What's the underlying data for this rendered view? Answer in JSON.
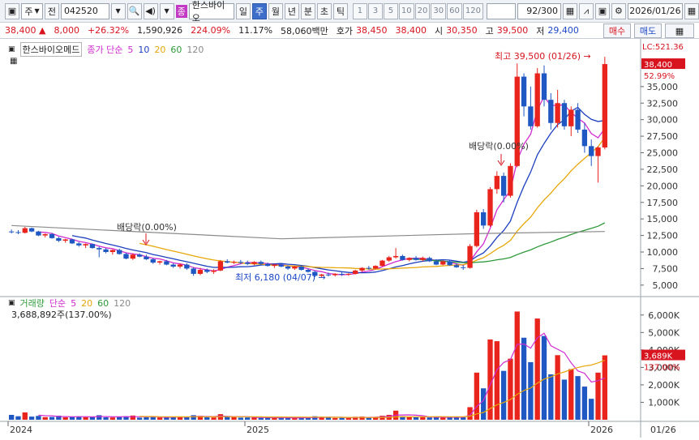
{
  "toolbar": {
    "type_label": "주",
    "prev_label": "전",
    "code": "042520",
    "badge": "종",
    "name": "한스바이오",
    "periods": [
      "일",
      "주",
      "월",
      "년",
      "분",
      "초",
      "틱"
    ],
    "active_period": "주",
    "intervals": [
      "1",
      "3",
      "5",
      "10",
      "20",
      "30",
      "60",
      "120"
    ],
    "count": "92/300",
    "date": "2026/01/26"
  },
  "quote": {
    "price": "38,400",
    "change": "8,000",
    "change_pct": "+26.32%",
    "volume": "1,590,926",
    "vol_ratio": "224.09%",
    "turnover": "11.17%",
    "amount": "58,060백만",
    "hoga_label": "호가",
    "ask": "38,450",
    "bid": "38,400",
    "open_label": "시",
    "open": "30,350",
    "high_label": "고",
    "high": "39,500",
    "low_label": "저",
    "low": "29,400",
    "buy_label": "매수",
    "sell_label": "매도"
  },
  "price_panel": {
    "title": "한스바이오메드",
    "ma_label": "종가 단순",
    "ma_periods": [
      "5",
      "10",
      "20",
      "60",
      "120"
    ],
    "lc_label": "LC:521.36",
    "current_price_tag": "38,400",
    "current_pct_tag": "52.99%",
    "max_annotation": "최고 39,500 (01/26)",
    "min_annotation": "최저 6,180 (04/07)",
    "div_annotation_1": "배당락(0.00%)",
    "div_annotation_2": "배당락(0.00%)",
    "y_ticks": [
      "35,000",
      "32,500",
      "30,000",
      "27,500",
      "25,000",
      "22,500",
      "20,000",
      "17,500",
      "15,000",
      "12,500",
      "10,000",
      "7,500",
      "5,000"
    ]
  },
  "volume_panel": {
    "title": "거래량",
    "ma_label": "단순",
    "ma_periods": [
      "5",
      "20",
      "60",
      "120"
    ],
    "last_volume": "3,688,892주(137.00%)",
    "current_tag": "3,689K",
    "current_pct_tag": "137.00%",
    "y_ticks": [
      "6,000K",
      "5,000K",
      "4,000K",
      "3,000K",
      "2,000K",
      "1,000K"
    ]
  },
  "x_axis": {
    "labels": [
      "2024",
      "2025",
      "2026"
    ],
    "right_label": "01/26"
  },
  "colors": {
    "up": "#e8241c",
    "down": "#1f57c3",
    "ma5": "#d02bd1",
    "ma10": "#1d3fbf",
    "ma20": "#e8a70a",
    "ma60": "#2d9a3a",
    "ma120": "#8a8a8a"
  },
  "chart_data": {
    "type": "candlestick",
    "price_ylim": [
      4000,
      40000
    ],
    "volume_ylim": [
      0,
      6500000
    ],
    "candles": [
      [
        13100,
        13400,
        12800,
        13000
      ],
      [
        13000,
        13300,
        12700,
        12900
      ],
      [
        12900,
        13800,
        12800,
        13600
      ],
      [
        13600,
        13700,
        13000,
        13100
      ],
      [
        13100,
        13200,
        12400,
        12500
      ],
      [
        12500,
        12800,
        12200,
        12700
      ],
      [
        12700,
        12900,
        12000,
        12100
      ],
      [
        12100,
        12300,
        11500,
        11700
      ],
      [
        11700,
        12000,
        11400,
        11900
      ],
      [
        11900,
        12000,
        11200,
        11300
      ],
      [
        11300,
        11500,
        10800,
        11000
      ],
      [
        11000,
        11300,
        10600,
        11200
      ],
      [
        11200,
        11300,
        10500,
        10600
      ],
      [
        10600,
        10800,
        9200,
        10400
      ],
      [
        10400,
        10600,
        9800,
        10000
      ],
      [
        10000,
        10400,
        9600,
        10300
      ],
      [
        10300,
        10500,
        9600,
        9700
      ],
      [
        9700,
        9900,
        8900,
        9000
      ],
      [
        9000,
        9800,
        8800,
        9600
      ],
      [
        9600,
        9800,
        9200,
        9300
      ],
      [
        9300,
        9600,
        8800,
        8900
      ],
      [
        8900,
        9100,
        8200,
        8400
      ],
      [
        8400,
        8700,
        8100,
        8600
      ],
      [
        8600,
        8800,
        8000,
        8100
      ],
      [
        8100,
        8300,
        7600,
        7800
      ],
      [
        7800,
        8300,
        7500,
        8100
      ],
      [
        8100,
        8300,
        7300,
        7500
      ],
      [
        7500,
        7700,
        6400,
        6700
      ],
      [
        6700,
        7600,
        6500,
        7300
      ],
      [
        7300,
        7500,
        6800,
        7000
      ],
      [
        7000,
        7400,
        6700,
        7200
      ],
      [
        7200,
        8800,
        7100,
        8600
      ],
      [
        8600,
        8900,
        8300,
        8400
      ],
      [
        8400,
        8700,
        8200,
        8500
      ],
      [
        8500,
        8800,
        8200,
        8400
      ],
      [
        8400,
        8700,
        8000,
        8200
      ],
      [
        8200,
        8600,
        8000,
        8500
      ],
      [
        8500,
        8700,
        8100,
        8200
      ],
      [
        8200,
        8400,
        7800,
        7900
      ],
      [
        7900,
        8200,
        7600,
        8100
      ],
      [
        8100,
        8300,
        7700,
        7800
      ],
      [
        7800,
        8000,
        7300,
        7500
      ],
      [
        7500,
        7900,
        7300,
        7800
      ],
      [
        7800,
        7900,
        7200,
        7300
      ],
      [
        7300,
        7500,
        6900,
        7000
      ],
      [
        7000,
        7200,
        6200,
        6400
      ],
      [
        6400,
        6700,
        6180,
        6600
      ],
      [
        6600,
        6900,
        6300,
        6500
      ],
      [
        6500,
        6800,
        6300,
        6700
      ],
      [
        6700,
        7000,
        6400,
        6600
      ],
      [
        6600,
        6800,
        6400,
        6700
      ],
      [
        6700,
        7300,
        6600,
        7200
      ],
      [
        7200,
        7700,
        7000,
        7600
      ],
      [
        7600,
        7900,
        7300,
        7500
      ],
      [
        7500,
        8000,
        7400,
        7900
      ],
      [
        7900,
        8800,
        7800,
        8700
      ],
      [
        8700,
        9400,
        8500,
        9200
      ],
      [
        9200,
        10600,
        9000,
        9400
      ],
      [
        9400,
        9600,
        8700,
        8800
      ],
      [
        8800,
        9200,
        8600,
        9100
      ],
      [
        9100,
        9400,
        8700,
        8800
      ],
      [
        8800,
        9300,
        8600,
        9100
      ],
      [
        9100,
        9300,
        8500,
        8600
      ],
      [
        8600,
        8900,
        8000,
        8100
      ],
      [
        8100,
        8700,
        8000,
        8600
      ],
      [
        8600,
        8800,
        7900,
        8000
      ],
      [
        8000,
        8300,
        7600,
        7700
      ],
      [
        7700,
        8000,
        7300,
        7600
      ],
      [
        7600,
        11200,
        7500,
        10900
      ],
      [
        10900,
        16400,
        10700,
        16000
      ],
      [
        16000,
        16500,
        13500,
        14000
      ],
      [
        14000,
        19800,
        13800,
        19500
      ],
      [
        19500,
        22200,
        18800,
        21500
      ],
      [
        21500,
        22000,
        17500,
        18500
      ],
      [
        18500,
        23400,
        18200,
        23000
      ],
      [
        23000,
        38500,
        22800,
        36500
      ],
      [
        36500,
        37000,
        30500,
        32000
      ],
      [
        32000,
        35000,
        28500,
        29000
      ],
      [
        29000,
        37800,
        28800,
        37000
      ],
      [
        37000,
        38200,
        32000,
        33000
      ],
      [
        33000,
        34000,
        28500,
        29500
      ],
      [
        29500,
        34500,
        28800,
        32500
      ],
      [
        32500,
        33000,
        28500,
        29000
      ],
      [
        29000,
        32000,
        27500,
        31500
      ],
      [
        31500,
        32500,
        28000,
        28500
      ],
      [
        28500,
        29500,
        25000,
        26000
      ],
      [
        26000,
        27000,
        23000,
        24500
      ],
      [
        24500,
        26000,
        20500,
        25800
      ],
      [
        25800,
        39500,
        25500,
        38400
      ]
    ],
    "volumes": [
      280000,
      200000,
      420000,
      180000,
      220000,
      150000,
      160000,
      230000,
      140000,
      170000,
      190000,
      150000,
      160000,
      260000,
      140000,
      130000,
      160000,
      200000,
      240000,
      120000,
      140000,
      170000,
      130000,
      140000,
      180000,
      160000,
      150000,
      260000,
      220000,
      140000,
      130000,
      320000,
      170000,
      140000,
      120000,
      130000,
      140000,
      110000,
      120000,
      100000,
      110000,
      130000,
      100000,
      110000,
      130000,
      200000,
      160000,
      120000,
      100000,
      110000,
      100000,
      170000,
      180000,
      120000,
      140000,
      230000,
      280000,
      520000,
      200000,
      160000,
      140000,
      150000,
      130000,
      160000,
      150000,
      130000,
      150000,
      140000,
      720000,
      2700000,
      1800000,
      4600000,
      4500000,
      2800000,
      3500000,
      6200000,
      4700000,
      3300000,
      5800000,
      4800000,
      2600000,
      3700000,
      2300000,
      2900000,
      2500000,
      1900000,
      1200000,
      2700000,
      3688892
    ],
    "volume_up": true
  }
}
